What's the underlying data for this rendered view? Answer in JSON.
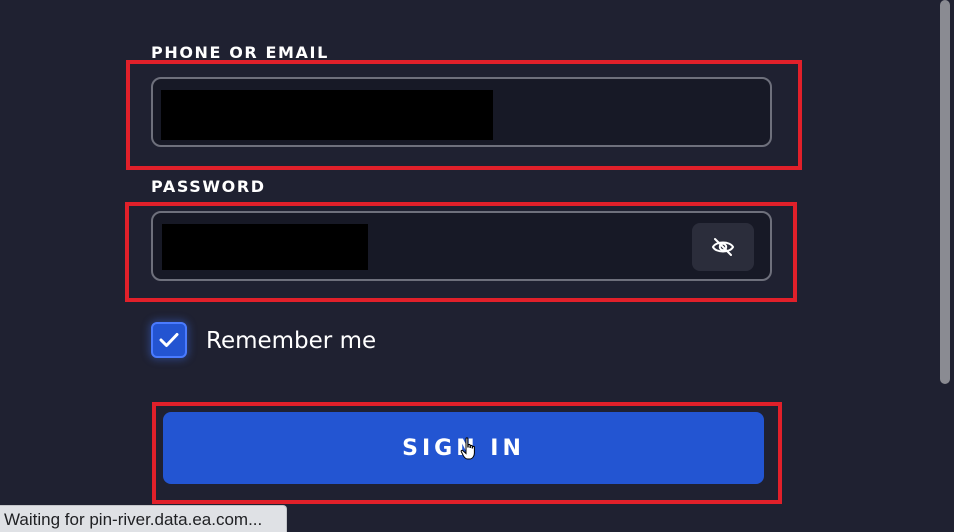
{
  "form": {
    "email_label": "PHONE OR EMAIL",
    "password_label": "PASSWORD",
    "remember_label": "Remember me",
    "remember_checked": true,
    "signin_label": "SIGN IN"
  },
  "icons": {
    "password_toggle": "eye-slash-icon",
    "checkbox": "checkmark-icon",
    "cursor": "hand-pointer-icon"
  },
  "browser": {
    "status_text": "Waiting for pin-river.data.ea.com..."
  },
  "colors": {
    "background": "#1f2131",
    "field_background": "#171926",
    "field_border": "#6e707c",
    "accent": "#2355d2",
    "highlight_box": "#e0202a"
  }
}
